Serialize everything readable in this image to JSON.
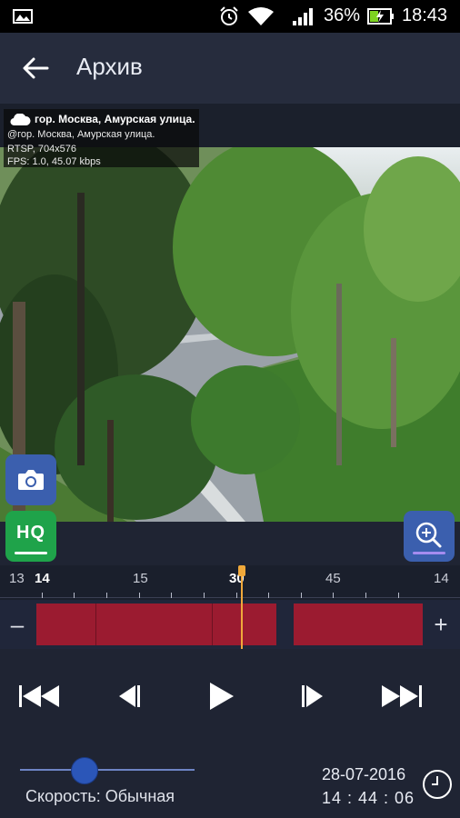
{
  "status_bar": {
    "battery": "36%",
    "time": "18:43"
  },
  "app_bar": {
    "title": "Архив"
  },
  "camera": {
    "name": "гор. Москва, Амурская улица.",
    "subtitle": "@гор. Москва, Амурская улица.",
    "stream": "RTSP, 704x576",
    "stats": "FPS: 1.0, 45.07 kbps"
  },
  "buttons": {
    "hq_label": "HQ"
  },
  "timeline": {
    "labels": [
      {
        "text": "13",
        "bold": false
      },
      {
        "text": "14",
        "bold": true
      },
      {
        "text": "15",
        "bold": false
      },
      {
        "text": "30",
        "bold": true
      },
      {
        "text": "45",
        "bold": false
      },
      {
        "text": "14",
        "bold": false
      }
    ],
    "zoom_out": "–",
    "zoom_in": "+",
    "record_color": "#9b1b30",
    "cursor_color": "#f0a83a"
  },
  "playback": {
    "controls": [
      "skip-to-start",
      "step-back",
      "play",
      "step-forward",
      "skip-to-end"
    ]
  },
  "speed": {
    "label": "Скорость: Обычная"
  },
  "datetime": {
    "date": "28-07-2016",
    "time": "14 : 44 : 06"
  },
  "colors": {
    "accent": "#3b5fae",
    "hq": "#1fa34a",
    "background": "#1f2433"
  }
}
